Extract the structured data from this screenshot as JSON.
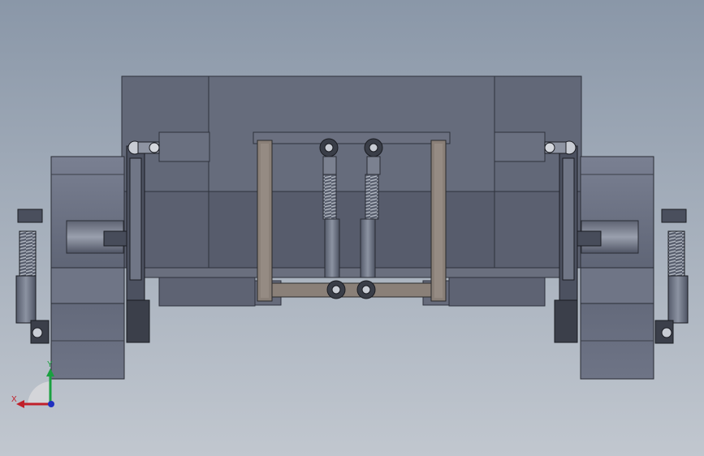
{
  "scene": {
    "background_top": "#8a97a8",
    "background_bottom": "#c1c7cf",
    "body_color": "#62687a",
    "body_dark": "#4f5566",
    "frame_color": "#8a8078",
    "spring_color": "#9aa2ae",
    "wheel_color": "#6b7182"
  },
  "triad": {
    "x_label": "X",
    "y_label": "Y",
    "x_color": "#c0202a",
    "y_color": "#1aa040",
    "z_color": "#2030c0"
  }
}
